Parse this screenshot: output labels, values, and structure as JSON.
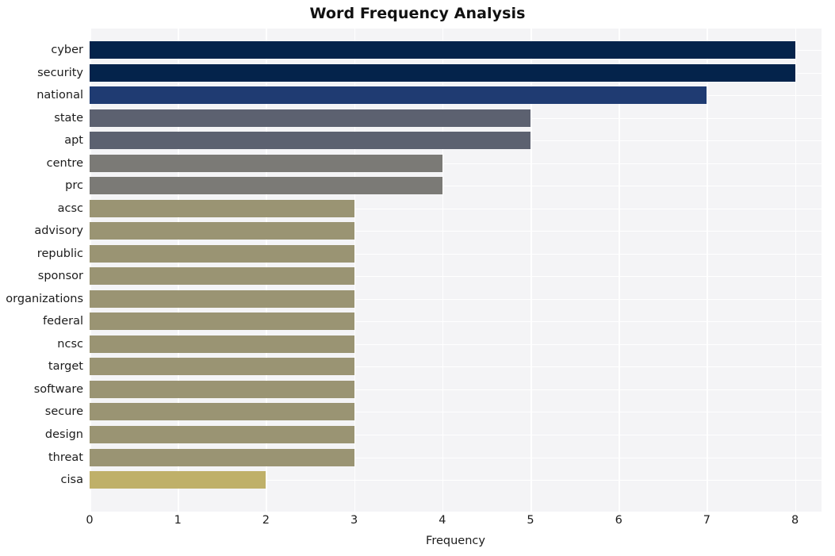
{
  "chart_data": {
    "type": "bar",
    "orientation": "horizontal",
    "title": "Word Frequency Analysis",
    "xlabel": "Frequency",
    "ylabel": "",
    "xlim": [
      0,
      8.3
    ],
    "xticks": [
      0,
      1,
      2,
      3,
      4,
      5,
      6,
      7,
      8
    ],
    "grid": true,
    "legend": null,
    "categories": [
      "cyber",
      "security",
      "national",
      "state",
      "apt",
      "centre",
      "prc",
      "acsc",
      "advisory",
      "republic",
      "sponsor",
      "organizations",
      "federal",
      "ncsc",
      "target",
      "software",
      "secure",
      "design",
      "threat",
      "cisa"
    ],
    "values": [
      8,
      8,
      7,
      5,
      5,
      4,
      4,
      3,
      3,
      3,
      3,
      3,
      3,
      3,
      3,
      3,
      3,
      3,
      3,
      2
    ],
    "bar_colors": [
      "#04234b",
      "#04234b",
      "#1f3b72",
      "#5c6170",
      "#5c6170",
      "#7b7a76",
      "#7b7a76",
      "#9a9473",
      "#9a9473",
      "#9a9473",
      "#9a9473",
      "#9a9473",
      "#9a9473",
      "#9a9473",
      "#9a9473",
      "#9a9473",
      "#9a9473",
      "#9a9473",
      "#9a9473",
      "#bfb069"
    ],
    "plot_background": "#f4f4f6",
    "grid_color": "#ffffff",
    "figure_background": "#ffffff"
  }
}
